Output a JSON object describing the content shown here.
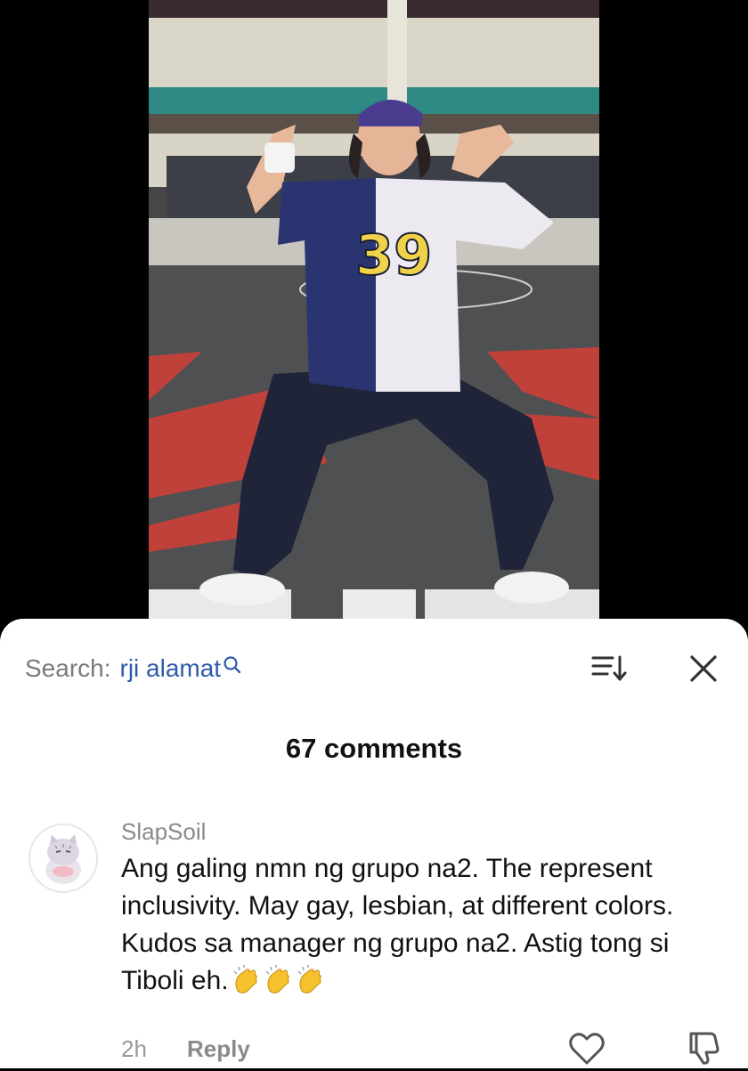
{
  "video": {
    "jersey_number": "39"
  },
  "search": {
    "label": "Search:",
    "term": "rji alamat"
  },
  "comments_header": {
    "count_text": "67 comments"
  },
  "comment": {
    "username": "SlapSoil",
    "text": "Ang galing nmn ng grupo na2. The represent inclusivity. May gay, lesbian, at different colors. Kudos sa manager ng grupo na2. Astig tong si Tiboli eh.",
    "reactions": [
      "clapping-hands",
      "clapping-hands",
      "clapping-hands"
    ],
    "timestamp": "2h",
    "reply_label": "Reply"
  },
  "icons": {
    "search": "magnifier-icon",
    "sort": "sort-icon",
    "close": "close-icon",
    "like": "heart-icon",
    "dislike": "thumbs-down-icon"
  },
  "colors": {
    "accent_link": "#2f5aa8",
    "muted_text": "#8a8a8a",
    "sheet_bg": "#ffffff"
  }
}
